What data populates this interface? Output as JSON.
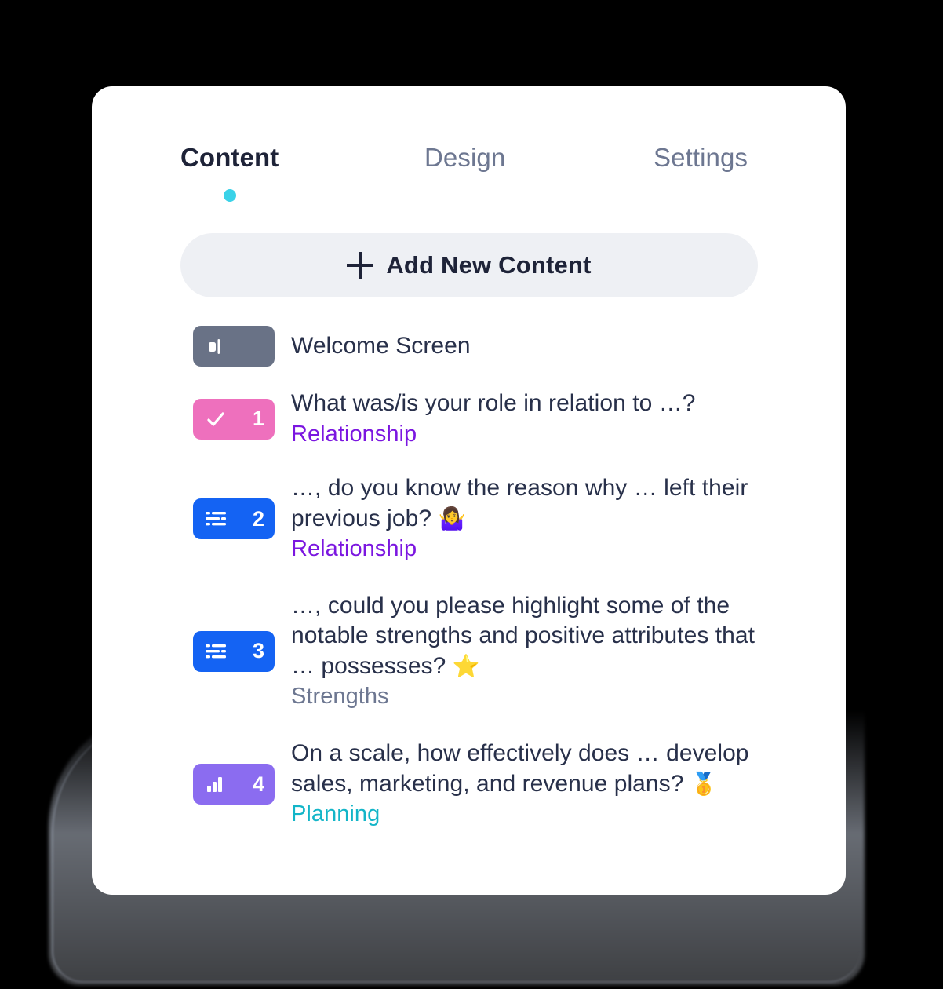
{
  "colors": {
    "accent_dot": "#3ad2e8",
    "tab_active": "#1e2338",
    "tab_inactive": "#6d7791",
    "add_button_bg": "#eef0f4",
    "badge_welcome": "#697286",
    "badge_pink": "#ee70bd",
    "badge_blue": "#1463f3",
    "badge_purple": "#8b6cf0",
    "cat_relationship": "#7b16e0",
    "cat_strengths": "#6d7791",
    "cat_planning": "#13b5c8",
    "card_bg": "#ffffff",
    "text_primary": "#28304a"
  },
  "tabs": [
    {
      "label": "Content",
      "active": true
    },
    {
      "label": "Design",
      "active": false
    },
    {
      "label": "Settings",
      "active": false
    }
  ],
  "toolbar": {
    "add_label": "Add New Content",
    "add_icon": "plus-icon"
  },
  "list": [
    {
      "type": "welcome",
      "icon": "presentation-screen-icon",
      "badge_color": "#697286",
      "number": "",
      "title": "Welcome Screen",
      "category": "",
      "category_color": ""
    },
    {
      "type": "multiple-choice",
      "icon": "checkmark-icon",
      "badge_color": "#ee70bd",
      "number": "1",
      "title": "What was/is your role in relation to …?",
      "emoji": "",
      "category": "Relationship",
      "category_color": "#7b16e0"
    },
    {
      "type": "long-text",
      "icon": "text-lines-icon",
      "badge_color": "#1463f3",
      "number": "2",
      "title": "…, do you know the reason why … left their previous job?",
      "emoji": "🤷‍♀️",
      "category": "Relationship",
      "category_color": "#7b16e0"
    },
    {
      "type": "long-text",
      "icon": "text-lines-icon",
      "badge_color": "#1463f3",
      "number": "3",
      "title": "…, could you please highlight some of the notable strengths and positive attributes that … possesses?",
      "emoji": "⭐",
      "category": "Strengths",
      "category_color": "#6d7791"
    },
    {
      "type": "rating-scale",
      "icon": "bar-chart-icon",
      "badge_color": "#8b6cf0",
      "number": "4",
      "title": "On a scale, how effectively does … develop sales, marketing, and revenue plans?",
      "emoji": "🥇",
      "category": "Planning",
      "category_color": "#13b5c8"
    }
  ]
}
